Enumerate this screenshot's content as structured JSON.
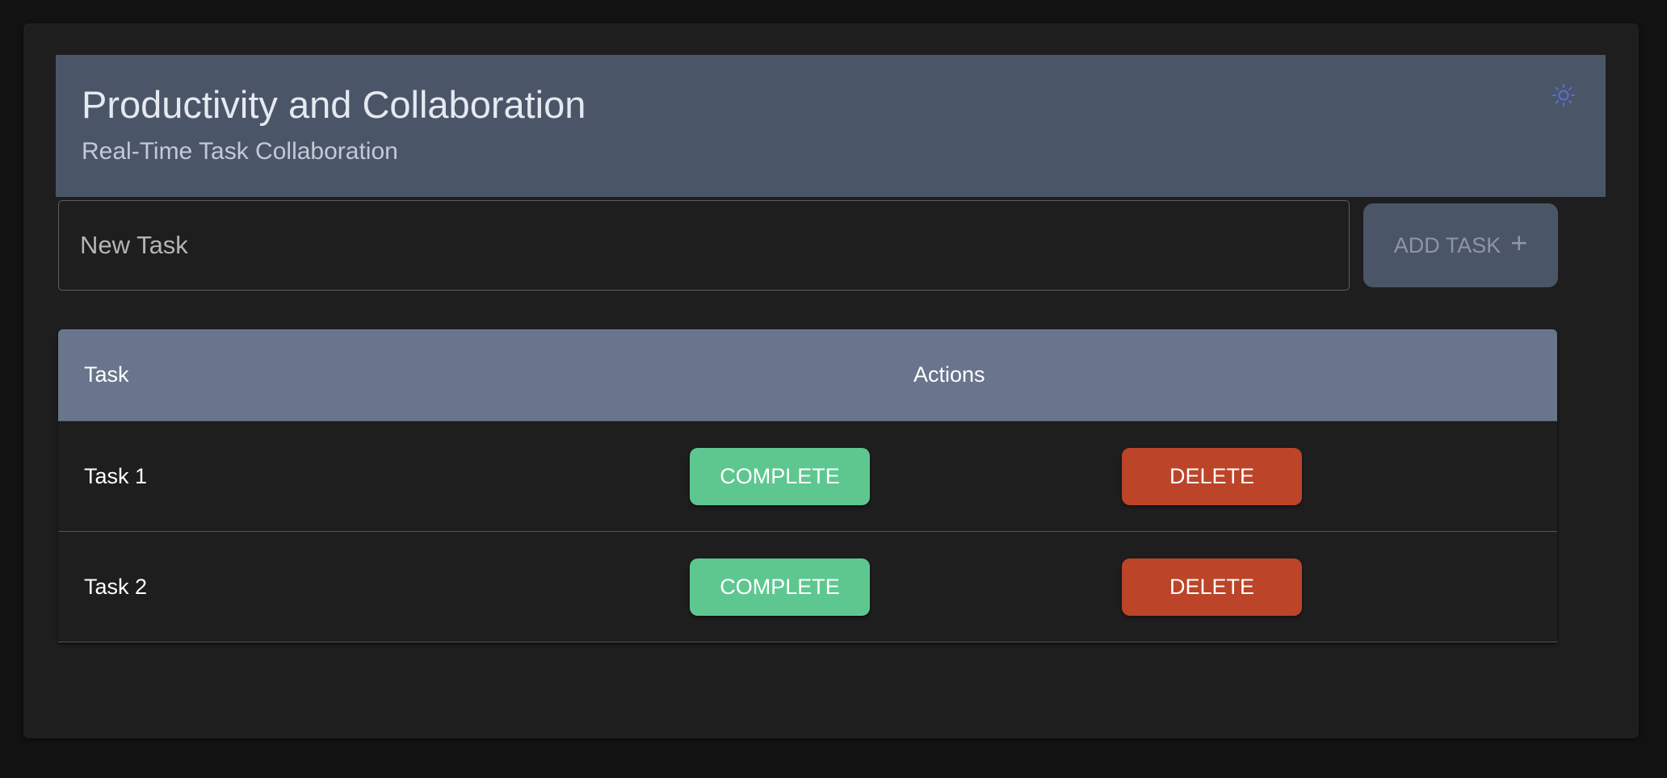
{
  "header": {
    "title": "Productivity and Collaboration",
    "subtitle": "Real-Time Task Collaboration",
    "theme_toggle_icon": "sun-icon"
  },
  "new_task": {
    "placeholder": "New Task",
    "value": "",
    "add_button_label": "ADD TASK",
    "add_button_icon": "plus-icon"
  },
  "table": {
    "columns": [
      "Task",
      "Actions"
    ],
    "rows": [
      {
        "task": "Task 1",
        "complete_label": "COMPLETE",
        "delete_label": "DELETE"
      },
      {
        "task": "Task 2",
        "complete_label": "COMPLETE",
        "delete_label": "DELETE"
      }
    ]
  },
  "colors": {
    "background": "#121212",
    "card": "#1e1e1e",
    "header": "#4a5568",
    "table_header": "#68758d",
    "complete": "#5ec790",
    "delete": "#bc4429",
    "accent_icon": "#5a6fd6"
  }
}
